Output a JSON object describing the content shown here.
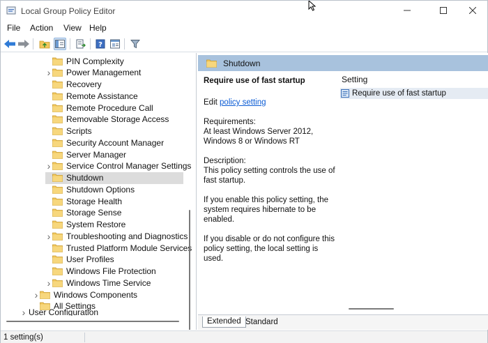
{
  "window": {
    "title": "Local Group Policy Editor",
    "buttons": {
      "minimize": "minimize-icon",
      "maximize": "maximize-icon",
      "close": "close-icon"
    }
  },
  "menu": {
    "file": "File",
    "action": "Action",
    "view": "View",
    "help": "Help"
  },
  "toolbar": {
    "icons": [
      "back-icon",
      "forward-icon",
      "up-folder-icon",
      "show-hide-tree-icon",
      "export-list-icon",
      "help-icon",
      "properties-icon",
      "filter-icon"
    ]
  },
  "tree": {
    "items": [
      {
        "label": "PIN Complexity",
        "expandable": false
      },
      {
        "label": "Power Management",
        "expandable": true
      },
      {
        "label": "Recovery",
        "expandable": false
      },
      {
        "label": "Remote Assistance",
        "expandable": false
      },
      {
        "label": "Remote Procedure Call",
        "expandable": false
      },
      {
        "label": "Removable Storage Access",
        "expandable": false
      },
      {
        "label": "Scripts",
        "expandable": false
      },
      {
        "label": "Security Account Manager",
        "expandable": false
      },
      {
        "label": "Server Manager",
        "expandable": false
      },
      {
        "label": "Service Control Manager Settings",
        "expandable": true
      },
      {
        "label": "Shutdown",
        "expandable": false,
        "selected": true
      },
      {
        "label": "Shutdown Options",
        "expandable": false
      },
      {
        "label": "Storage Health",
        "expandable": false
      },
      {
        "label": "Storage Sense",
        "expandable": false
      },
      {
        "label": "System Restore",
        "expandable": false
      },
      {
        "label": "Troubleshooting and Diagnostics",
        "expandable": true
      },
      {
        "label": "Trusted Platform Module Services",
        "expandable": false
      },
      {
        "label": "User Profiles",
        "expandable": false
      },
      {
        "label": "Windows File Protection",
        "expandable": false
      },
      {
        "label": "Windows Time Service",
        "expandable": true
      }
    ],
    "parent_items": [
      {
        "label": "Windows Components",
        "expandable": true
      },
      {
        "label": "All Settings",
        "expandable": false
      }
    ],
    "partial_item": "User Configuration"
  },
  "pane": {
    "header": "Shutdown",
    "policy_title": "Require use of fast startup",
    "edit_prefix": "Edit",
    "edit_link": "policy setting",
    "requirements_label": "Requirements:",
    "requirements_text": "At least Windows Server 2012, Windows 8 or Windows RT",
    "description_label": "Description:",
    "description_text": "This policy setting controls the use of fast startup.",
    "enable_text": "If you enable this policy setting, the system requires hibernate to be enabled.",
    "disable_text": "If you disable or do not configure this policy setting, the local setting is used."
  },
  "list": {
    "column_header": "Setting",
    "rows": [
      {
        "label": "Require use of fast startup",
        "icon": "policy-setting-icon"
      }
    ]
  },
  "tabs": {
    "extended": "Extended",
    "standard": "Standard"
  },
  "status": {
    "text": "1 setting(s)"
  },
  "colors": {
    "header_bg": "#a8c2dd",
    "link": "#0a5bd4",
    "folder": "#f2c75c",
    "selected_row": "#dcdcdc"
  }
}
